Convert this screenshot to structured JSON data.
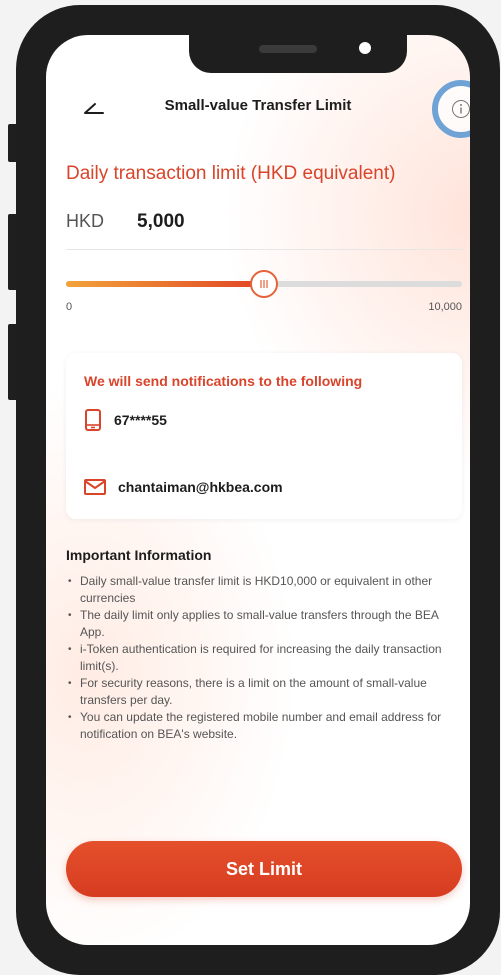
{
  "header": {
    "title": "Small-value Transfer Limit",
    "back_icon": "back-arrow-icon",
    "info_icon": "info-icon"
  },
  "limit": {
    "heading": "Daily transaction limit (HKD equivalent)",
    "currency": "HKD",
    "amount": "5,000",
    "slider": {
      "min_label": "0",
      "max_label": "10,000",
      "value": 5000,
      "min": 0,
      "max": 10000
    }
  },
  "notifications": {
    "title": "We will send notifications to the following",
    "phone": "67****55",
    "email": "chantaiman@hkbea.com",
    "phone_icon": "mobile-phone-icon",
    "email_icon": "envelope-icon"
  },
  "important": {
    "heading": "Important Information",
    "items": [
      "Daily small-value transfer limit is HKD10,000 or equivalent in other currencies",
      "The daily limit only applies to small-value transfers through the BEA App.",
      "i-Token authentication is required for increasing the daily transaction limit(s).",
      "For security reasons, there is a limit on the amount of small-value transfers per day.",
      "You can update the registered mobile number and email address for notification on BEA's website."
    ]
  },
  "actions": {
    "set_limit_label": "Set Limit"
  },
  "colors": {
    "accent": "#d9442b",
    "highlight_ring": "#6fa3d6",
    "slider_start": "#f2a33a",
    "slider_end": "#e14424"
  }
}
